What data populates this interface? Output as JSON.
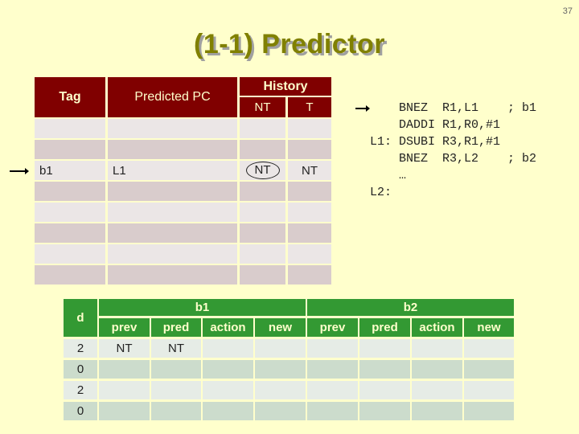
{
  "slide_number": "37",
  "title": "(1-1) Predictor",
  "btb_table": {
    "headers": {
      "tag": "Tag",
      "predicted_pc": "Predicted PC",
      "history": "History",
      "history_nt": "NT",
      "history_t": "T"
    },
    "rows": [
      {
        "tag": "",
        "pc": "",
        "nt": "",
        "t": "",
        "pointer": false,
        "circled": false
      },
      {
        "tag": "",
        "pc": "",
        "nt": "",
        "t": "",
        "pointer": false,
        "circled": false
      },
      {
        "tag": "b1",
        "pc": "L1",
        "nt": "NT",
        "t": "NT",
        "pointer": true,
        "circled": true
      },
      {
        "tag": "",
        "pc": "",
        "nt": "",
        "t": "",
        "pointer": false,
        "circled": false
      },
      {
        "tag": "",
        "pc": "",
        "nt": "",
        "t": "",
        "pointer": false,
        "circled": false
      },
      {
        "tag": "",
        "pc": "",
        "nt": "",
        "t": "",
        "pointer": false,
        "circled": false
      },
      {
        "tag": "",
        "pc": "",
        "nt": "",
        "t": "",
        "pointer": false,
        "circled": false
      },
      {
        "tag": "",
        "pc": "",
        "nt": "",
        "t": "",
        "pointer": false,
        "circled": false
      }
    ]
  },
  "code": {
    "lines": [
      "    BNEZ  R1,L1    ; b1",
      "    DADDI R1,R0,#1",
      "L1: DSUBI R3,R1,#1",
      "    BNEZ  R3,L2    ; b2",
      "    …",
      "L2:"
    ],
    "pointer_line": 0
  },
  "trace_table": {
    "headers": {
      "d": "d",
      "b1": "b1",
      "b2": "b2",
      "sub": [
        "prev",
        "pred",
        "action",
        "new",
        "prev",
        "pred",
        "action",
        "new"
      ]
    },
    "rows": [
      {
        "d": "2",
        "cells": [
          "NT",
          "NT",
          "",
          "",
          "",
          "",
          "",
          ""
        ]
      },
      {
        "d": "0",
        "cells": [
          "",
          "",
          "",
          "",
          "",
          "",
          "",
          ""
        ]
      },
      {
        "d": "2",
        "cells": [
          "",
          "",
          "",
          "",
          "",
          "",
          "",
          ""
        ]
      },
      {
        "d": "0",
        "cells": [
          "",
          "",
          "",
          "",
          "",
          "",
          "",
          ""
        ]
      }
    ]
  },
  "colors": {
    "background": "#ffffcc",
    "title": "#808000",
    "btb_header": "#800000",
    "trace_header": "#339933"
  }
}
